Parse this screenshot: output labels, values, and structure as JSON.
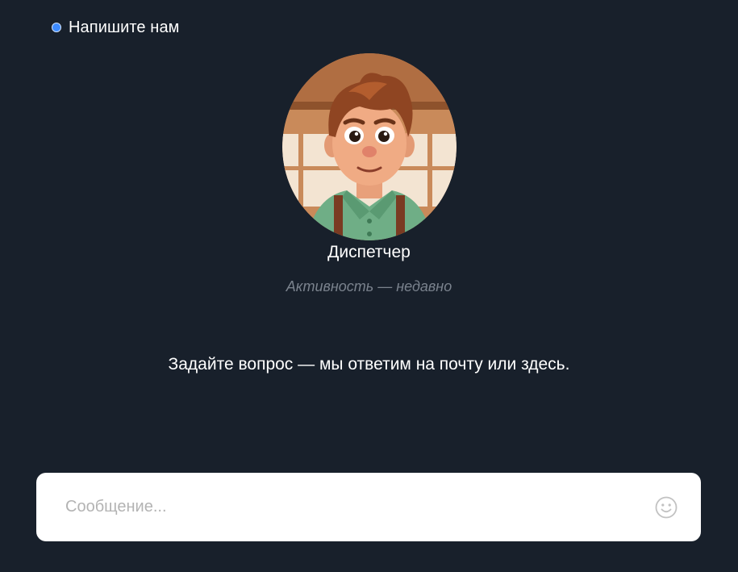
{
  "header": {
    "title": "Напишите нам",
    "status_color": "#3d8bff"
  },
  "agent": {
    "name": "Диспетчер",
    "activity": "Активность — недавно"
  },
  "prompt": "Задайте вопрос — мы ответим на почту или здесь.",
  "composer": {
    "placeholder": "Сообщение...",
    "emoji_icon": "smiley-icon"
  },
  "colors": {
    "background": "#18202b",
    "composer_background": "#ffffff",
    "muted_text": "#7a828d"
  }
}
